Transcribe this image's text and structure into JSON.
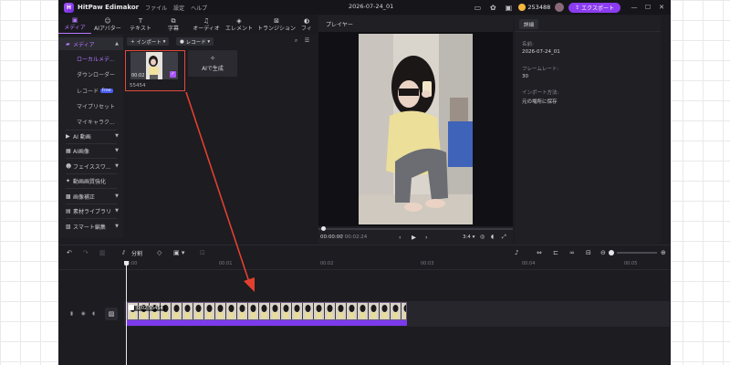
{
  "titlebar": {
    "app_name": "HitPaw Edimakor",
    "menu": [
      "ファイル",
      "設定",
      "ヘルプ"
    ],
    "project_title": "2026-07-24_01",
    "coins": "253488",
    "export_label": "エクスポート"
  },
  "toolbar": {
    "tools": [
      {
        "label": "メディア",
        "icon": "media-icon"
      },
      {
        "label": "AIアバター",
        "icon": "avatar-icon"
      },
      {
        "label": "テキスト",
        "icon": "text-icon"
      },
      {
        "label": "字幕",
        "icon": "subtitle-icon"
      },
      {
        "label": "オーディオ",
        "icon": "music-icon"
      },
      {
        "label": "エレメント",
        "icon": "element-icon"
      },
      {
        "label": "トランジション",
        "icon": "transition-icon"
      },
      {
        "label": "フィ",
        "icon": "filter-icon"
      }
    ]
  },
  "sidebar": {
    "media_label": "メディア",
    "sub_items": [
      "ローカルメデ...",
      "ダウンローダー",
      "レコード",
      "マイプリセット",
      "マイキャラク..."
    ],
    "free_badge": "Free",
    "groups": [
      "AI 動画",
      "AI画像",
      "フェイススワ...",
      "動画画質強化",
      "画像補正",
      "素材ライブラリ",
      "スマート編集"
    ]
  },
  "media": {
    "import_label": "インポート",
    "record_label": "レコード",
    "clip_duration": "00:02",
    "clip_name": "55454",
    "ai_generate_label": "AIで生成"
  },
  "player": {
    "title": "プレイヤー",
    "time_current": "00:00:00",
    "time_total": "/ 00:02:24",
    "ratio": "3:4"
  },
  "properties": {
    "tab_label": "詳細",
    "fields": [
      {
        "label": "名前:",
        "value": "2026-07-24_01"
      },
      {
        "label": "フレームレート:",
        "value": "30"
      },
      {
        "label": "インポート方法:",
        "value": "元の場所に保存"
      }
    ]
  },
  "timeline": {
    "split_label": "分割",
    "ruler_labels": [
      "00:00",
      "00:01",
      "00:02",
      "00:03",
      "00:04",
      "00:05"
    ],
    "clip_label": "0:02 55454"
  },
  "colors": {
    "accent": "#a855f7",
    "highlight": "#e24a3c",
    "audio_track": "#7c3aed"
  }
}
